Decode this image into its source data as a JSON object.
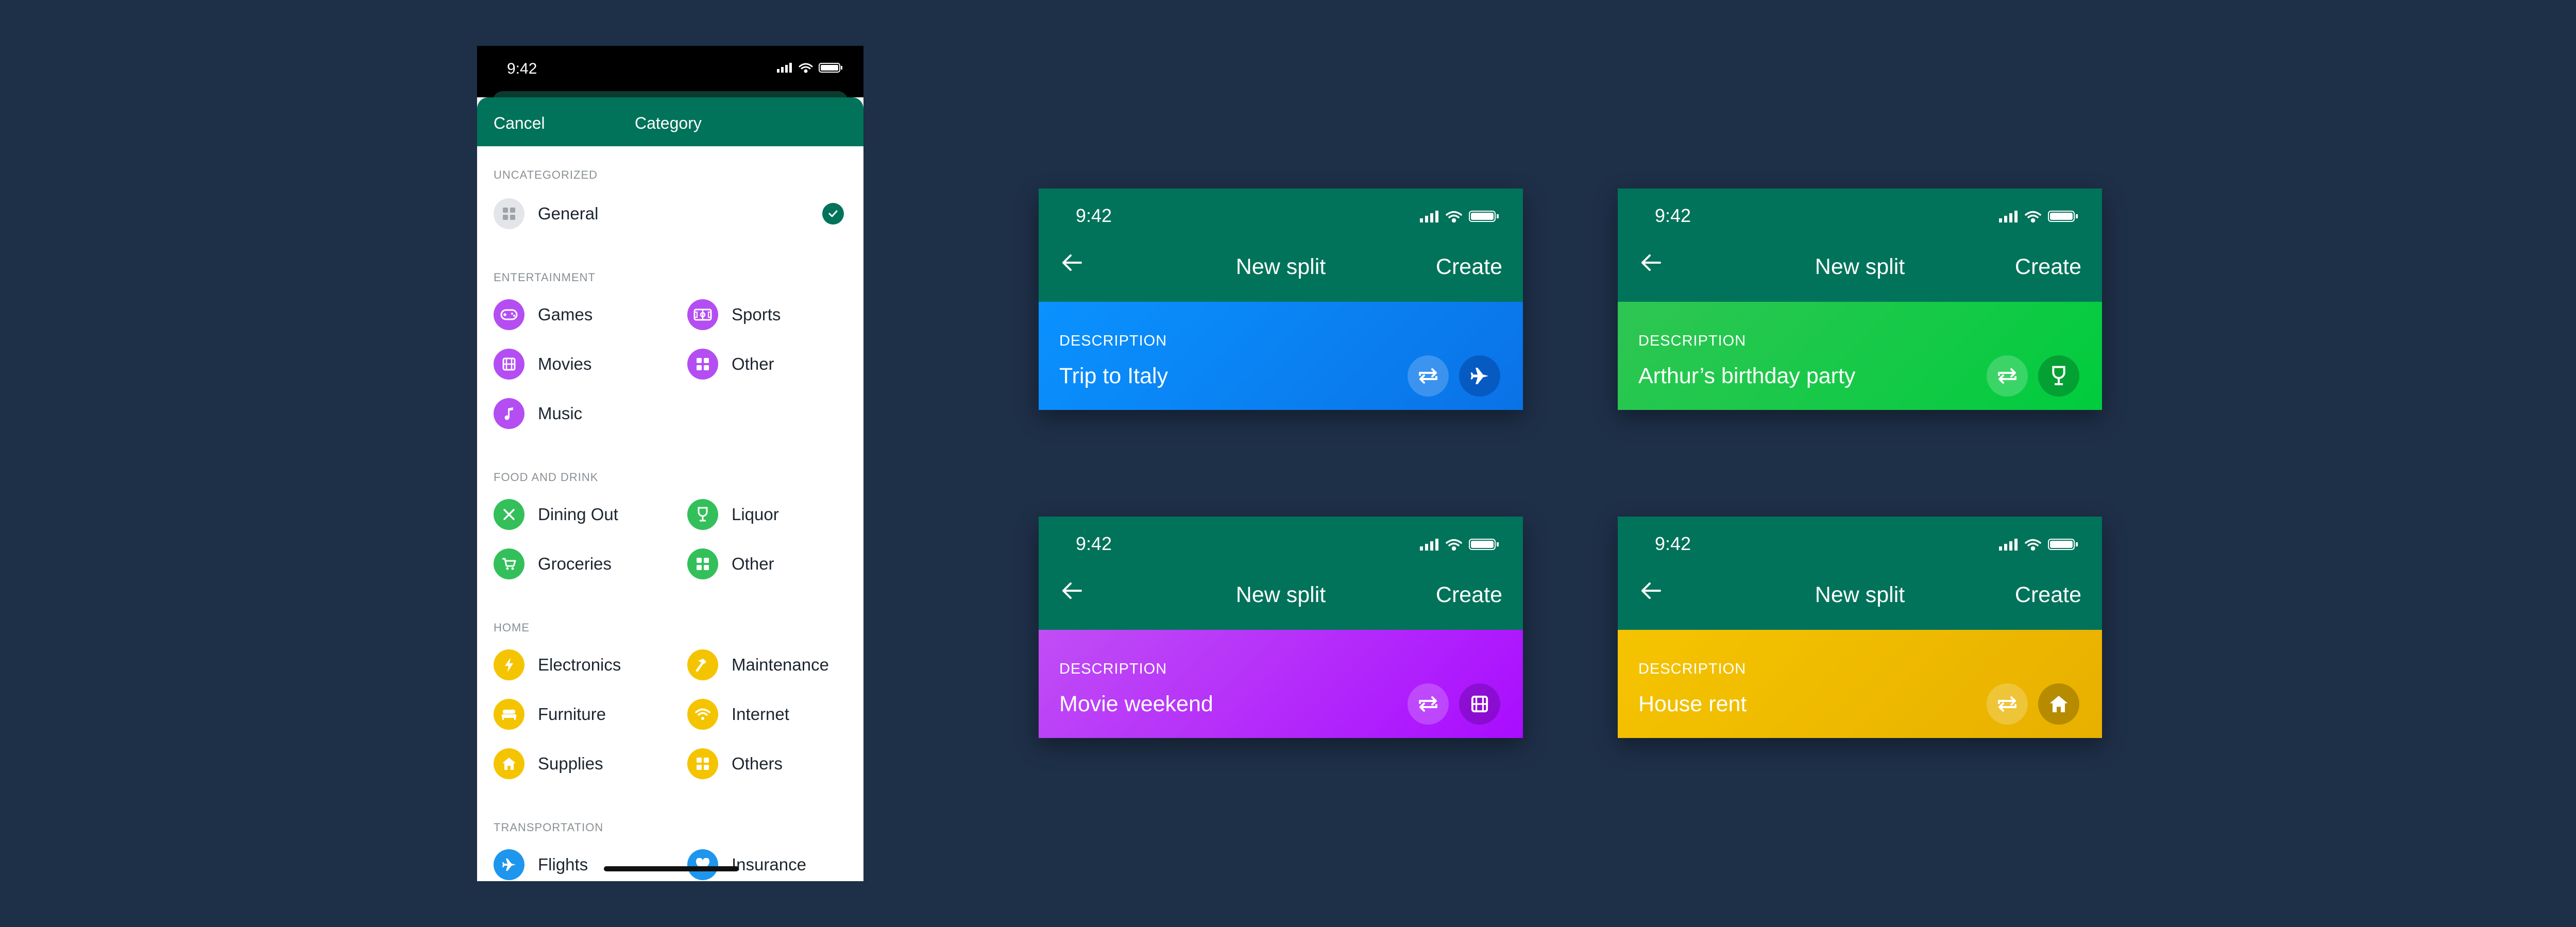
{
  "category_screen": {
    "status_time": "9:42",
    "cancel_label": "Cancel",
    "title": "Category",
    "sections": [
      {
        "header": "UNCATEGORIZED",
        "items": [
          {
            "label": "General",
            "icon": "grid-icon",
            "color": "#d9dcdf",
            "selected": true
          }
        ]
      },
      {
        "header": "ENTERTAINMENT",
        "items": [
          {
            "label": "Games",
            "icon": "gamepad-icon",
            "color": "#b44ef2"
          },
          {
            "label": "Sports",
            "icon": "sports-field-icon",
            "color": "#b44ef2"
          },
          {
            "label": "Movies",
            "icon": "film-icon",
            "color": "#b44ef2"
          },
          {
            "label": "Other",
            "icon": "grid-icon",
            "color": "#b44ef2"
          },
          {
            "label": "Music",
            "icon": "music-note-icon",
            "color": "#b44ef2"
          }
        ]
      },
      {
        "header": "FOOD AND DRINK",
        "items": [
          {
            "label": "Dining Out",
            "icon": "utensils-icon",
            "color": "#33c05a"
          },
          {
            "label": "Liquor",
            "icon": "wine-glass-icon",
            "color": "#33c05a"
          },
          {
            "label": "Groceries",
            "icon": "cart-icon",
            "color": "#33c05a"
          },
          {
            "label": "Other",
            "icon": "grid-icon",
            "color": "#33c05a"
          }
        ]
      },
      {
        "header": "HOME",
        "items": [
          {
            "label": "Electronics",
            "icon": "lightning-icon",
            "color": "#f5c400"
          },
          {
            "label": "Maintenance",
            "icon": "hammer-icon",
            "color": "#f5c400"
          },
          {
            "label": "Furniture",
            "icon": "bed-icon",
            "color": "#f5c400"
          },
          {
            "label": "Internet",
            "icon": "wifi-icon",
            "color": "#f5c400"
          },
          {
            "label": "Supplies",
            "icon": "house-icon",
            "color": "#f5c400"
          },
          {
            "label": "Others",
            "icon": "grid-icon",
            "color": "#f5c400"
          }
        ]
      },
      {
        "header": "TRANSPORTATION",
        "items": [
          {
            "label": "Flights",
            "icon": "airplane-icon",
            "color": "#1e96ee"
          },
          {
            "label": "Insurance",
            "icon": "heart-icon",
            "color": "#1e96ee"
          }
        ]
      }
    ]
  },
  "split_cards": [
    {
      "status_time": "9:42",
      "title": "New split",
      "create_label": "Create",
      "description_label": "DESCRIPTION",
      "description": "Trip to Italy",
      "gradient": [
        "#0a92ff",
        "#0a72e6"
      ],
      "category_icon": "airplane-icon"
    },
    {
      "status_time": "9:42",
      "title": "New split",
      "create_label": "Create",
      "description_label": "DESCRIPTION",
      "description": "Arthur’s birthday party",
      "gradient": [
        "#2fc653",
        "#00cc3d"
      ],
      "category_icon": "wine-glass-icon"
    },
    {
      "status_time": "9:42",
      "title": "New split",
      "create_label": "Create",
      "description_label": "DESCRIPTION",
      "description": "Movie weekend",
      "gradient": [
        "#c04ef5",
        "#a90cff"
      ],
      "category_icon": "film-icon"
    },
    {
      "status_time": "9:42",
      "title": "New split",
      "create_label": "Create",
      "description_label": "DESCRIPTION",
      "description": "House rent",
      "gradient": [
        "#f5c400",
        "#e8b000"
      ],
      "category_icon": "house-icon"
    }
  ]
}
